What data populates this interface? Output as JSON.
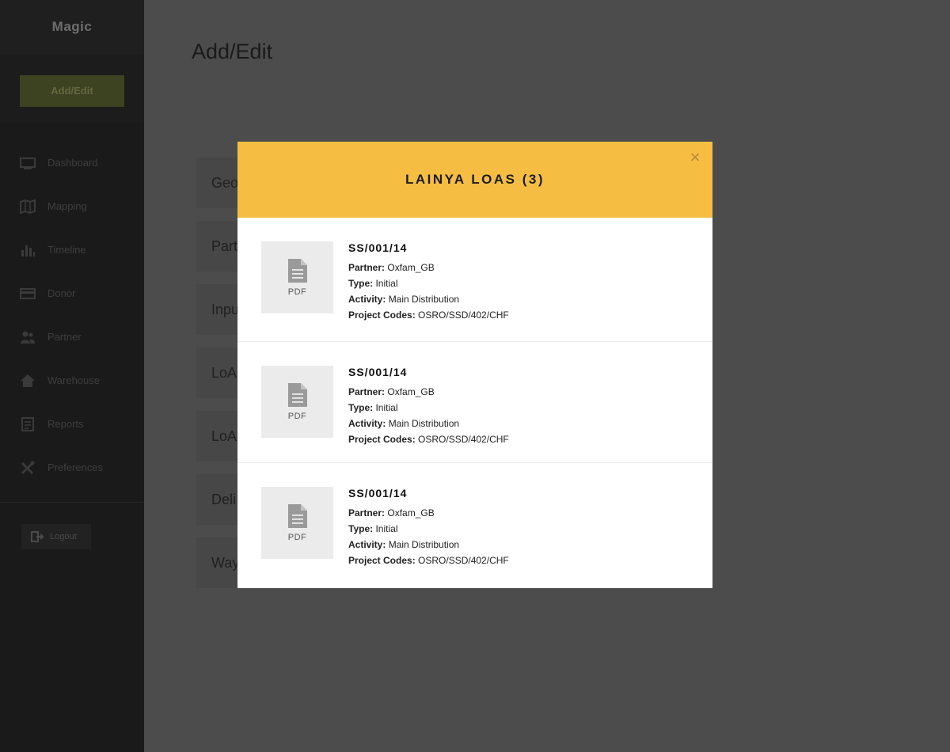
{
  "app": {
    "brand": "Magic"
  },
  "sidebar": {
    "add_edit_label": "Add/Edit",
    "items": [
      {
        "label": "Dashboard",
        "icon": "monitor-icon"
      },
      {
        "label": "Mapping",
        "icon": "map-icon"
      },
      {
        "label": "Timeline",
        "icon": "bar-chart-icon"
      },
      {
        "label": "Donor",
        "icon": "card-icon"
      },
      {
        "label": "Partner",
        "icon": "users-icon"
      },
      {
        "label": "Warehouse",
        "icon": "house-icon"
      },
      {
        "label": "Reports",
        "icon": "report-icon"
      },
      {
        "label": "Preferences",
        "icon": "tools-icon"
      }
    ],
    "logout_label": "Logout"
  },
  "main": {
    "title": "Add/Edit",
    "rows": [
      "Geo",
      "Part",
      "Inpu",
      "LoA",
      "LoA",
      "Deli",
      "Way"
    ]
  },
  "modal": {
    "title": "LAINYA LOAS (3)",
    "close_glyph": "×",
    "entries": [
      {
        "file_type": "PDF",
        "code": "SS/001/14",
        "partner": "Oxfam_GB",
        "type": "Initial",
        "activity": "Main Distribution",
        "project_codes": "OSRO/SSD/402/CHF"
      },
      {
        "file_type": "PDF",
        "code": "SS/001/14",
        "partner": "Oxfam_GB",
        "type": "Initial",
        "activity": "Main Distribution",
        "project_codes": "OSRO/SSD/402/CHF"
      },
      {
        "file_type": "PDF",
        "code": "SS/001/14",
        "partner": "Oxfam_GB",
        "type": "Initial",
        "activity": "Main Distribution",
        "project_codes": "OSRO/SSD/402/CHF"
      }
    ],
    "field_labels": {
      "partner": "Partner:",
      "type": "Type:",
      "activity": "Activity:",
      "project_codes": "Project Codes:"
    }
  },
  "colors": {
    "accent": "#f6bd43",
    "sidebar_bg": "#1a1a1a",
    "overlay_bg": "#4c4c4c",
    "add_edit_bg": "#3d4221"
  }
}
